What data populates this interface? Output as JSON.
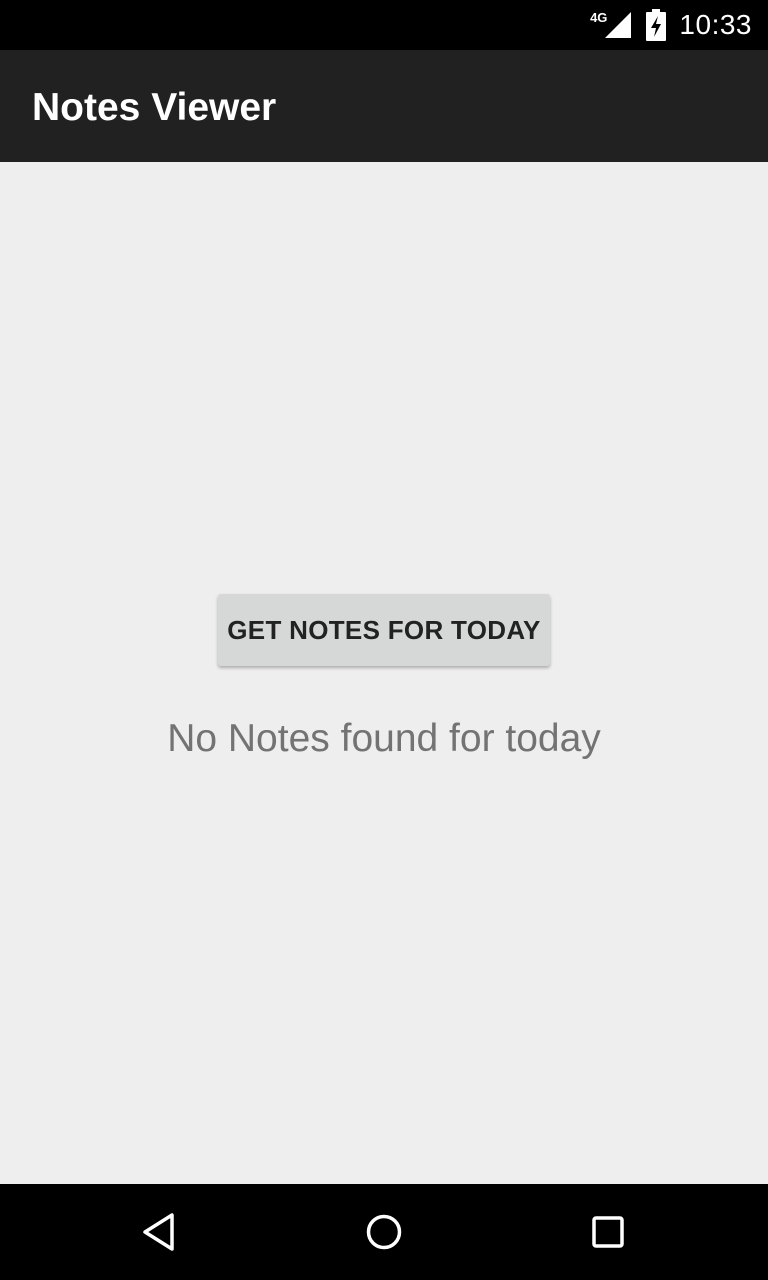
{
  "status_bar": {
    "network_label": "4G",
    "time": "10:33",
    "icons": [
      "signal-icon",
      "battery-charging-icon"
    ]
  },
  "app_bar": {
    "title": "Notes Viewer",
    "background_color": "#212121"
  },
  "main": {
    "button_label": "GET NOTES FOR TODAY",
    "empty_message": "No Notes found for today",
    "background_color": "#eeeeee"
  },
  "nav_bar": {
    "icons": [
      "back-icon",
      "home-icon",
      "recents-icon"
    ]
  }
}
